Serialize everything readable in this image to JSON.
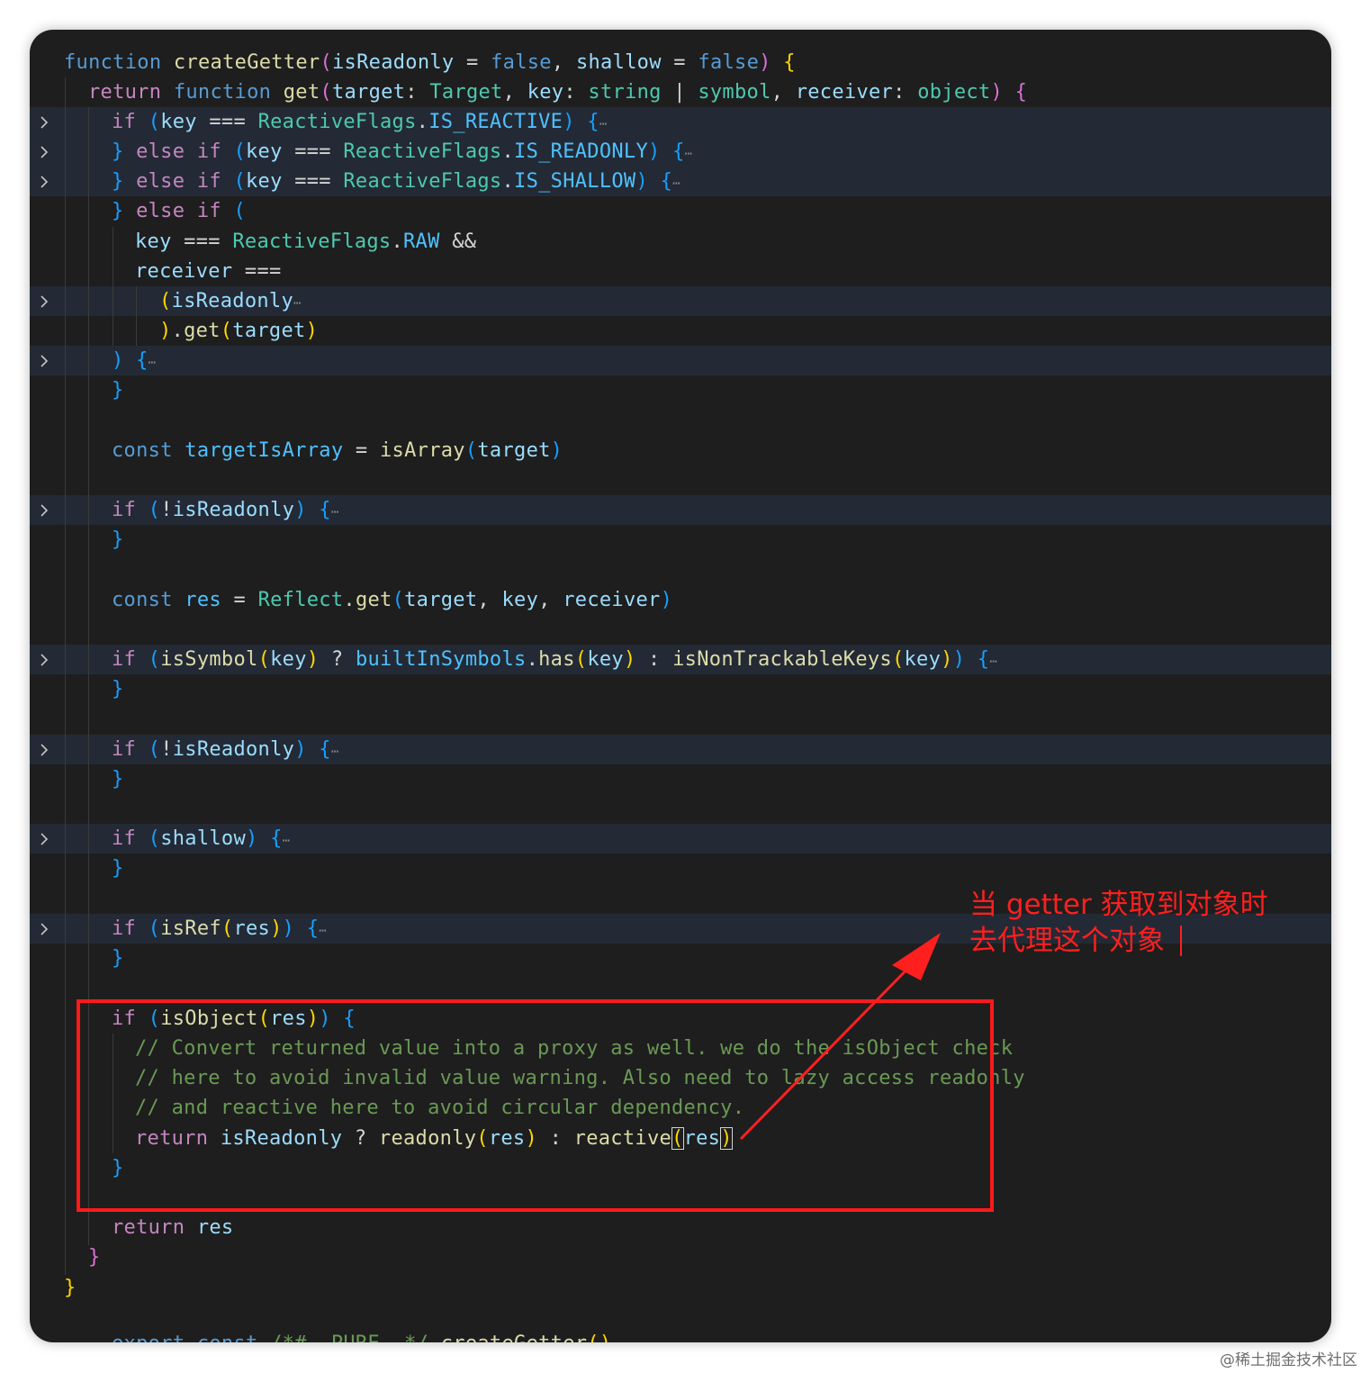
{
  "editor": {
    "lines": [
      [
        "function",
        " ",
        "createGetter",
        "(",
        "isReadonly",
        " = ",
        "false",
        ", ",
        "shallow",
        " = ",
        "false",
        ")",
        " ",
        "{"
      ],
      [
        "return",
        " ",
        "function",
        " ",
        "get",
        "(",
        "target",
        ": ",
        "Target",
        ", ",
        "key",
        ": ",
        "string",
        " | ",
        "symbol",
        ", ",
        "receiver",
        ": ",
        "object",
        ")",
        " ",
        "{"
      ],
      [
        "if",
        " ",
        "(",
        "key",
        " === ",
        "ReactiveFlags",
        ".",
        "IS_REACTIVE",
        ")",
        " ",
        "{",
        "⋯"
      ],
      [
        "}",
        " ",
        "else",
        " ",
        "if",
        " ",
        "(",
        "key",
        " === ",
        "ReactiveFlags",
        ".",
        "IS_READONLY",
        ")",
        " ",
        "{",
        "⋯"
      ],
      [
        "}",
        " ",
        "else",
        " ",
        "if",
        " ",
        "(",
        "key",
        " === ",
        "ReactiveFlags",
        ".",
        "IS_SHALLOW",
        ")",
        " ",
        "{",
        "⋯"
      ],
      [
        "}",
        " ",
        "else",
        " ",
        "if",
        " ",
        "("
      ],
      [
        "key",
        " === ",
        "ReactiveFlags",
        ".",
        "RAW",
        " &&"
      ],
      [
        "receiver",
        " ==="
      ],
      [
        "(",
        "isReadonly",
        "⋯"
      ],
      [
        ")",
        ".",
        "get",
        "(",
        "target",
        ")"
      ],
      [
        ")",
        " ",
        "{",
        "⋯"
      ],
      [
        "}"
      ],
      [
        "const",
        " ",
        "targetIsArray",
        " = ",
        "isArray",
        "(",
        "target",
        ")"
      ],
      [
        "if",
        " ",
        "(",
        "!",
        "isReadonly",
        ")",
        " ",
        "{",
        "⋯"
      ],
      [
        "}"
      ],
      [
        "const",
        " ",
        "res",
        " = ",
        "Reflect",
        ".",
        "get",
        "(",
        "target",
        ", ",
        "key",
        ", ",
        "receiver",
        ")"
      ],
      [
        "if",
        " ",
        "(",
        "isSymbol",
        "(",
        "key",
        ")",
        " ? ",
        "builtInSymbols",
        ".",
        "has",
        "(",
        "key",
        ")",
        " : ",
        "isNonTrackableKeys",
        "(",
        "key",
        ")",
        ")",
        " ",
        "{",
        "⋯"
      ],
      [
        "}"
      ],
      [
        "if",
        " ",
        "(",
        "!",
        "isReadonly",
        ")",
        " ",
        "{",
        "⋯"
      ],
      [
        "}"
      ],
      [
        "if",
        " ",
        "(",
        "shallow",
        ")",
        " ",
        "{",
        "⋯"
      ],
      [
        "}"
      ],
      [
        "if",
        " ",
        "(",
        "isRef",
        "(",
        "res",
        ")",
        ")",
        " ",
        "{",
        "⋯"
      ],
      [
        "}"
      ],
      [
        "if",
        " ",
        "(",
        "isObject",
        "(",
        "res",
        ")",
        ")",
        " ",
        "{"
      ],
      [
        "// Convert returned value into a proxy as well. we do the isObject check"
      ],
      [
        "// here to avoid invalid value warning. Also need to lazy access readonly"
      ],
      [
        "// and reactive here to avoid circular dependency."
      ],
      [
        "return",
        " ",
        "isReadonly",
        " ? ",
        "readonly",
        "(",
        "res",
        ")",
        " : ",
        "reactive",
        "(",
        "res",
        ")"
      ],
      [
        "}"
      ],
      [
        "return",
        " ",
        "res"
      ],
      [
        "}"
      ],
      [
        "}"
      ],
      [
        "export",
        " ",
        "const",
        " ",
        "/*#__PURE__*/",
        " ",
        "createGetter",
        "()"
      ]
    ]
  },
  "annotation": {
    "line1": "当 getter 获取到对象时",
    "line2": "去代理这个对象"
  },
  "watermark": "@稀土掘金技术社区",
  "icons": {
    "fold": "chevron-right-icon",
    "arrow": "arrow-icon"
  },
  "colors": {
    "background": "#1e1e1e",
    "keyword": "#569cd6",
    "control": "#c586c0",
    "function": "#dcdcaa",
    "variable": "#9cdcfe",
    "type": "#4ec9b0",
    "constant": "#4fc1ff",
    "comment": "#6a9955",
    "annotation": "#ff1f1f"
  }
}
